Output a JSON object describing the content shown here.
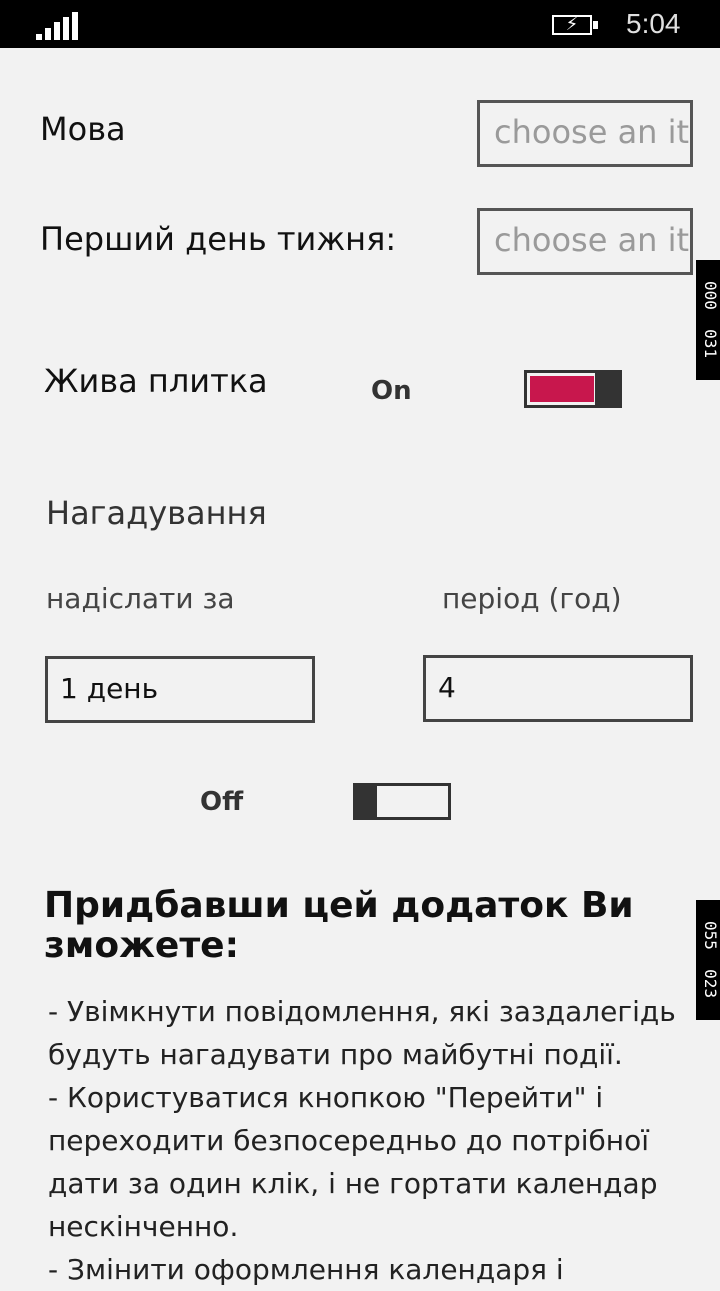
{
  "status": {
    "time": "5:04"
  },
  "settings": {
    "language_label": "Мова",
    "language_placeholder": "choose an it",
    "first_day_label": "Перший день тижня:",
    "first_day_placeholder": "choose an it",
    "live_tile_label": "Жива плитка",
    "live_tile_state": "On",
    "live_tile_color": "#c8174d",
    "reminders_heading": "Нагадування",
    "send_before_label": "надіслати за",
    "period_label": "період (год)",
    "send_before_value": "1 день",
    "period_value": "4",
    "reminder_state": "Off"
  },
  "promo": {
    "title": "Придбавши цей додаток Ви зможете:",
    "lines": [
      "- Увімкнути повідомлення, які заздалегідь будуть нагадувати про майбутні події.",
      "- Користуватися кнопкою \"Перейти\" і переходити безпосередньо до потрібної дати за один клік, і не гортати календар нескінченно.",
      "- Змінити оформлення календаря і"
    ]
  },
  "side_tags": [
    {
      "top": "000",
      "bottom": "031"
    },
    {
      "top": "055",
      "bottom": "023"
    }
  ]
}
